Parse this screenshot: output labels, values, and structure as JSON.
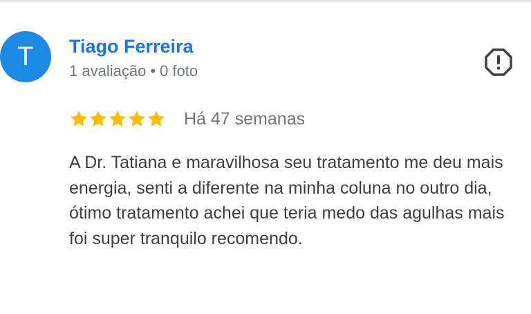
{
  "review": {
    "author": {
      "initial": "T",
      "name": "Tiago Ferreira",
      "reviews_count": "1 avaliação",
      "separator": "•",
      "photos_count": "0 foto",
      "avatar_color": "#1e88e5"
    },
    "rating": 5,
    "rating_max": 5,
    "star_color": "#fbbc04",
    "time_ago": "Há 47 semanas",
    "text": "A Dr. Tatiana e maravilhosa seu tratamento me deu mais energia, senti a diferente na minha coluna no outro dia, ótimo tratamento achei que teria medo das agulhas mais foi super tranquilo recomendo.",
    "report_icon": "report-octagon-icon"
  }
}
